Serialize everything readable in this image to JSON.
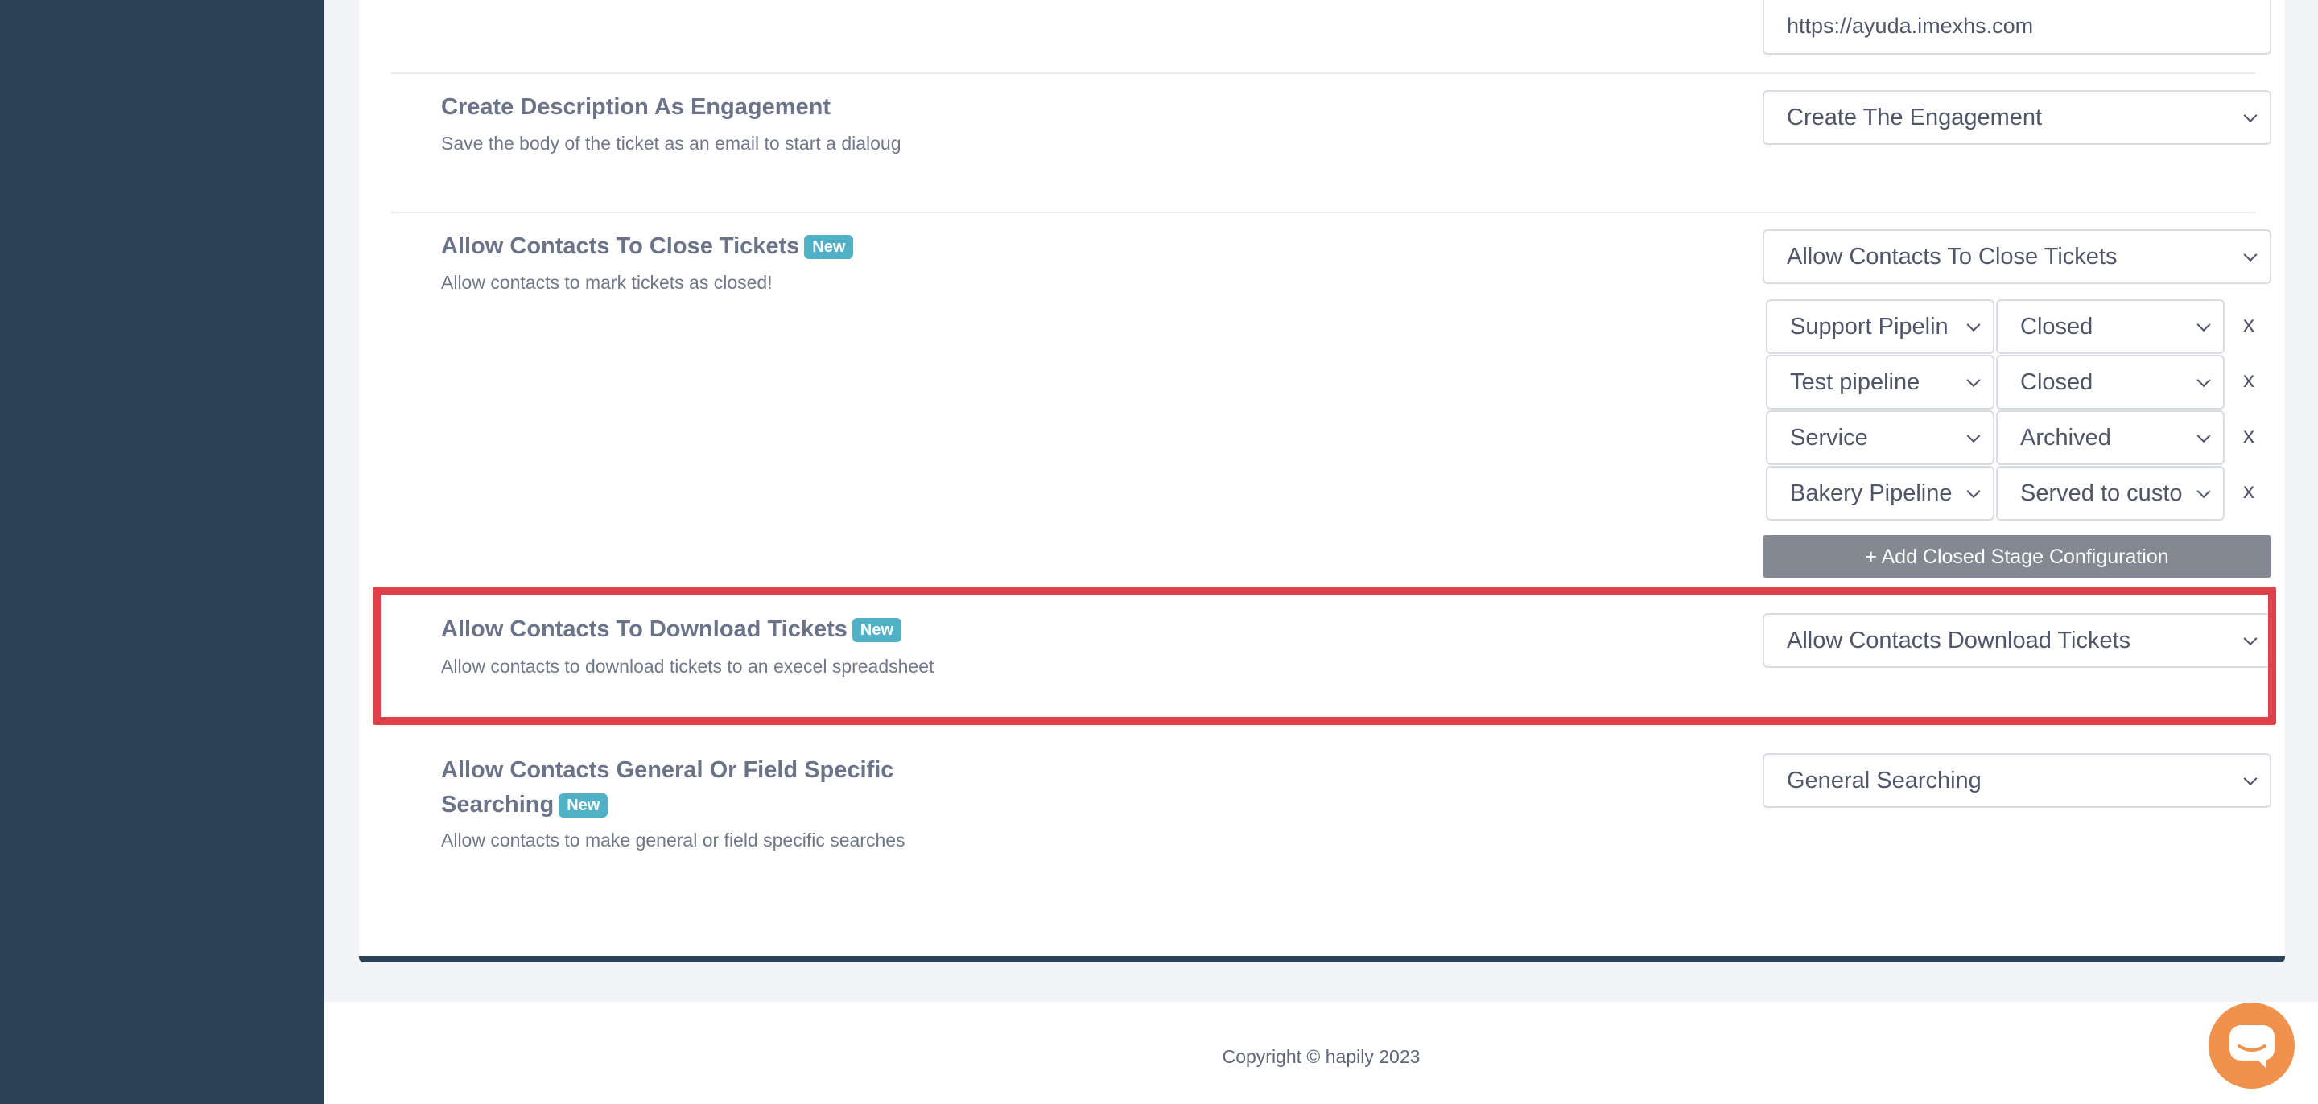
{
  "url_field": {
    "value": "https://ayuda.imexhs.com"
  },
  "settings": {
    "engagement": {
      "title": "Create Description As Engagement",
      "description": "Save the body of the ticket as an email to start a dialoug",
      "selected": "Create The Engagement"
    },
    "close_tickets": {
      "title": "Allow Contacts To Close Tickets",
      "badge": "New",
      "description": "Allow contacts to mark tickets as closed!",
      "selected": "Allow Contacts To Close Tickets",
      "rows": [
        {
          "pipeline": "Support Pipelin",
          "stage": "Closed",
          "remove": "x"
        },
        {
          "pipeline": "Test pipeline",
          "stage": "Closed",
          "remove": "x"
        },
        {
          "pipeline": "Service",
          "stage": "Archived",
          "remove": "x"
        },
        {
          "pipeline": "Bakery Pipeline",
          "stage": "Served to custo",
          "remove": "x"
        }
      ],
      "add_button": "+ Add Closed Stage Configuration"
    },
    "download_tickets": {
      "title": "Allow Contacts To Download Tickets",
      "badge": "New",
      "description": "Allow contacts to download tickets to an execel spreadsheet",
      "selected": "Allow Contacts Download Tickets"
    },
    "searching": {
      "title_line1": "Allow Contacts General Or Field Specific",
      "title_line2": "Searching",
      "badge": "New",
      "description": "Allow contacts to make general or field specific searches",
      "selected": "General Searching"
    }
  },
  "footer": {
    "copyright": "Copyright © hapily 2023"
  },
  "colors": {
    "sidebar": "#2e4257",
    "badge": "#4fb0c6",
    "highlight": "#e0404a",
    "chat": "#f0924e",
    "button": "#838893"
  },
  "icons": {
    "chevron": "chevron-down-icon",
    "chat": "chat-icon"
  }
}
